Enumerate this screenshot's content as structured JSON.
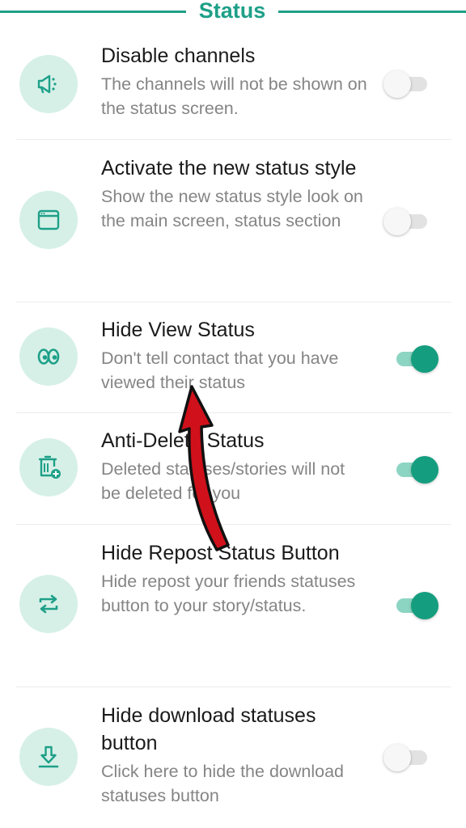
{
  "section": {
    "title": "Status"
  },
  "colors": {
    "accent": "#1ea088",
    "icon_bg": "#d6f0e8",
    "arrow": "#d0101a"
  },
  "settings": [
    {
      "title": "Disable channels",
      "desc": "The channels will not be shown on the status screen.",
      "icon": "megaphone-icon",
      "enabled": false
    },
    {
      "title": "Activate the new status style",
      "desc": "Show the new status style look on the main screen, status section",
      "icon": "window-icon",
      "enabled": false
    },
    {
      "title": "Hide View Status",
      "desc": "Don't tell contact that you have viewed their status",
      "icon": "eyes-icon",
      "enabled": true
    },
    {
      "title": "Anti-Delete Status",
      "desc": "Deleted statuses/stories will not be deleted for you",
      "icon": "trash-plus-icon",
      "enabled": true
    },
    {
      "title": "Hide Repost Status Button",
      "desc": "Hide repost your friends statuses button to your story/status.",
      "icon": "repost-icon",
      "enabled": true
    },
    {
      "title": "Hide download statuses button",
      "desc": "Click here to hide the download statuses button",
      "icon": "download-icon",
      "enabled": false
    }
  ]
}
